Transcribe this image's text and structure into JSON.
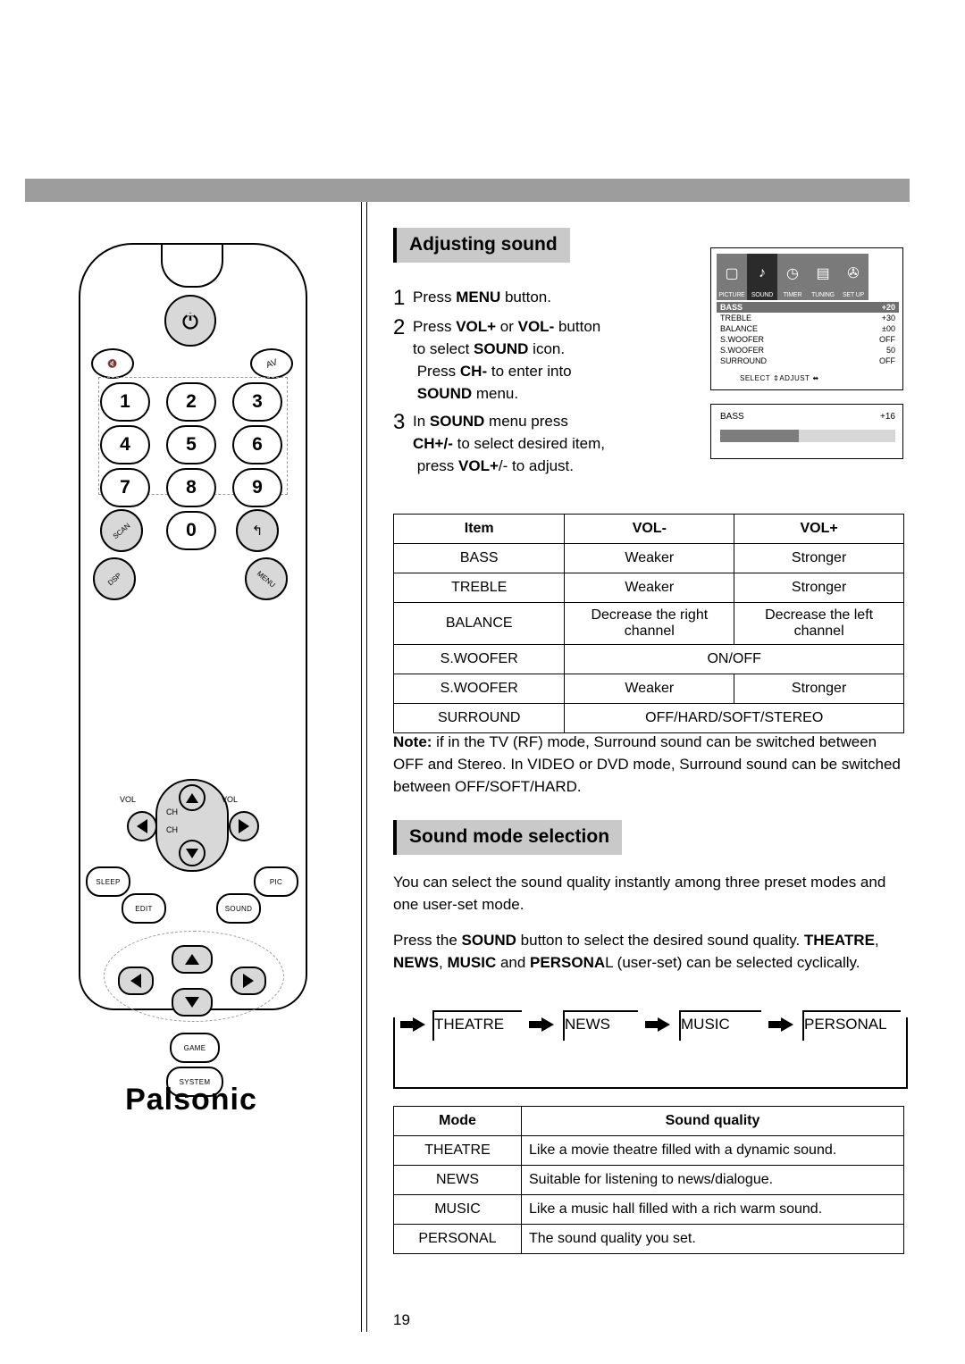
{
  "page_number": "19",
  "brand": "Palsonic",
  "remote": {
    "power_icon": "power-icon",
    "mute_label": "MUTE",
    "av_label": "AV",
    "numbers": [
      "1",
      "2",
      "3",
      "4",
      "5",
      "6",
      "7",
      "8",
      "9",
      "0"
    ],
    "scan_label": "SCAN",
    "recall_label": "RECALL",
    "dsp_label": "DSP",
    "menu_label": "MENU",
    "vol_left_label": "VOL",
    "vol_right_label": "VOL",
    "ch_up_label": "CH",
    "ch_down_label": "CH",
    "sleep_label": "SLEEP",
    "pic_label": "PIC",
    "edit_label": "EDIT",
    "sound_label": "SOUND",
    "game_label": "GAME",
    "system_label": "SYSTEM"
  },
  "sections": {
    "adjusting_sound": {
      "title": "Adjusting sound",
      "steps": [
        {
          "num": "1",
          "html": "Press <b>MENU</b> button."
        },
        {
          "num": "2",
          "html": "Press <b>VOL+</b> or <b>VOL-</b> button<br>to select <b>SOUND</b> icon.<br>&nbsp;Press <b>CH-</b> to enter into<br>&nbsp;<b>SOUND</b> menu."
        },
        {
          "num": "3",
          "html": "In <b>SOUND</b> menu press<br><b>CH+/-</b> to select desired item,<br>&nbsp;press <b>VOL+</b>/- to adjust."
        }
      ],
      "note_html": "<b>Note:</b> if in the TV (RF) mode, Surround sound can be switched between OFF and Stereo. In VIDEO or DVD mode, Surround sound can be switched between OFF/SOFT/HARD."
    },
    "sound_mode": {
      "title": "Sound mode selection",
      "para1": "You can select the sound quality instantly among three preset modes and one user-set mode.",
      "para2_html": "Press the <b>SOUND</b> button to select the desired sound quality. <b>THEATRE</b>, <b>NEWS</b>, <b>MUSIC</b> and <b>PERSONA</b>L (user-set) can be selected cyclically.",
      "flow": [
        "THEATRE",
        "NEWS",
        "MUSIC",
        "PERSONAL"
      ]
    }
  },
  "osd_menu": {
    "icons": [
      {
        "label": "PICTURE",
        "glyph": "▭",
        "selected": false
      },
      {
        "label": "SOUND",
        "glyph": "♪",
        "selected": true
      },
      {
        "label": "TIMER",
        "glyph": "⏱",
        "selected": false
      },
      {
        "label": "TUNING",
        "glyph": "📺",
        "selected": false
      },
      {
        "label": "SET UP",
        "glyph": "⚙",
        "selected": false
      }
    ],
    "rows": [
      {
        "name": "BASS",
        "value": "+20",
        "highlight": true
      },
      {
        "name": "TREBLE",
        "value": "+30",
        "highlight": false
      },
      {
        "name": "BALANCE",
        "value": "±00",
        "highlight": false
      },
      {
        "name": "S.WOOFER",
        "value": "OFF",
        "highlight": false
      },
      {
        "name": "S.WOOFER",
        "value": "50",
        "highlight": false
      },
      {
        "name": "SURROUND",
        "value": "OFF",
        "highlight": false
      }
    ],
    "footer_select": "SELECT",
    "footer_select_icon": "up-down-arrows-icon",
    "footer_adjust": "ADJUST",
    "footer_adjust_icon": "left-right-arrows-icon"
  },
  "osd_bar": {
    "label": "BASS",
    "value": "+16",
    "fill_percent": 45
  },
  "item_table": {
    "headers": [
      "Item",
      "VOL-",
      "VOL+"
    ],
    "rows": [
      {
        "item": "BASS",
        "minus": "Weaker",
        "plus": "Stronger",
        "span": false
      },
      {
        "item": "TREBLE",
        "minus": "Weaker",
        "plus": "Stronger",
        "span": false
      },
      {
        "item": "BALANCE",
        "minus": "Decrease the right channel",
        "plus": "Decrease the left channel",
        "span": false
      },
      {
        "item": "S.WOOFER",
        "minus": "ON/OFF",
        "plus": "",
        "span": true
      },
      {
        "item": "S.WOOFER",
        "minus": "Weaker",
        "plus": "Stronger",
        "span": false
      },
      {
        "item": "SURROUND",
        "minus": "OFF/HARD/SOFT/STEREO",
        "plus": "",
        "span": true
      }
    ]
  },
  "mode_table": {
    "headers": [
      "Mode",
      "Sound quality"
    ],
    "rows": [
      {
        "mode": "THEATRE",
        "quality": "Like a movie theatre filled with a dynamic sound."
      },
      {
        "mode": "NEWS",
        "quality": "Suitable for listening to news/dialogue."
      },
      {
        "mode": "MUSIC",
        "quality": "Like a music hall filled with a rich warm sound."
      },
      {
        "mode": "PERSONAL",
        "quality": "The sound quality you set."
      }
    ]
  }
}
